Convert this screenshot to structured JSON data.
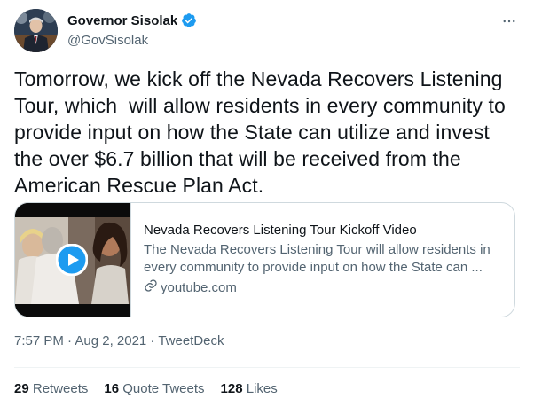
{
  "author": {
    "display_name": "Governor Sisolak",
    "handle": "@GovSisolak"
  },
  "tweet": {
    "text": "Tomorrow, we kick off the Nevada Recovers Listening Tour, which  will allow residents in every community to provide input on how the State can utilize and invest the over $6.7 billion that will be received from the American Rescue Plan Act."
  },
  "card": {
    "title": "Nevada Recovers Listening Tour Kickoff Video",
    "description": "The Nevada Recovers Listening Tour will allow residents in every community to provide input on how the State can ...",
    "domain": "youtube.com"
  },
  "meta": {
    "timestamp": "7:57 PM · Aug 2, 2021 · TweetDeck"
  },
  "stats": {
    "retweets_count": "29",
    "retweets_label": "Retweets",
    "quotes_count": "16",
    "quotes_label": "Quote Tweets",
    "likes_count": "128",
    "likes_label": "Likes"
  },
  "icons": {
    "verified": "verified-badge-icon",
    "more": "more-horizontal-icon",
    "play": "play-icon",
    "link": "link-icon"
  },
  "colors": {
    "accent": "#1d9bf0",
    "text": "#0f1419",
    "secondary": "#536471",
    "border": "#cfd9de"
  }
}
